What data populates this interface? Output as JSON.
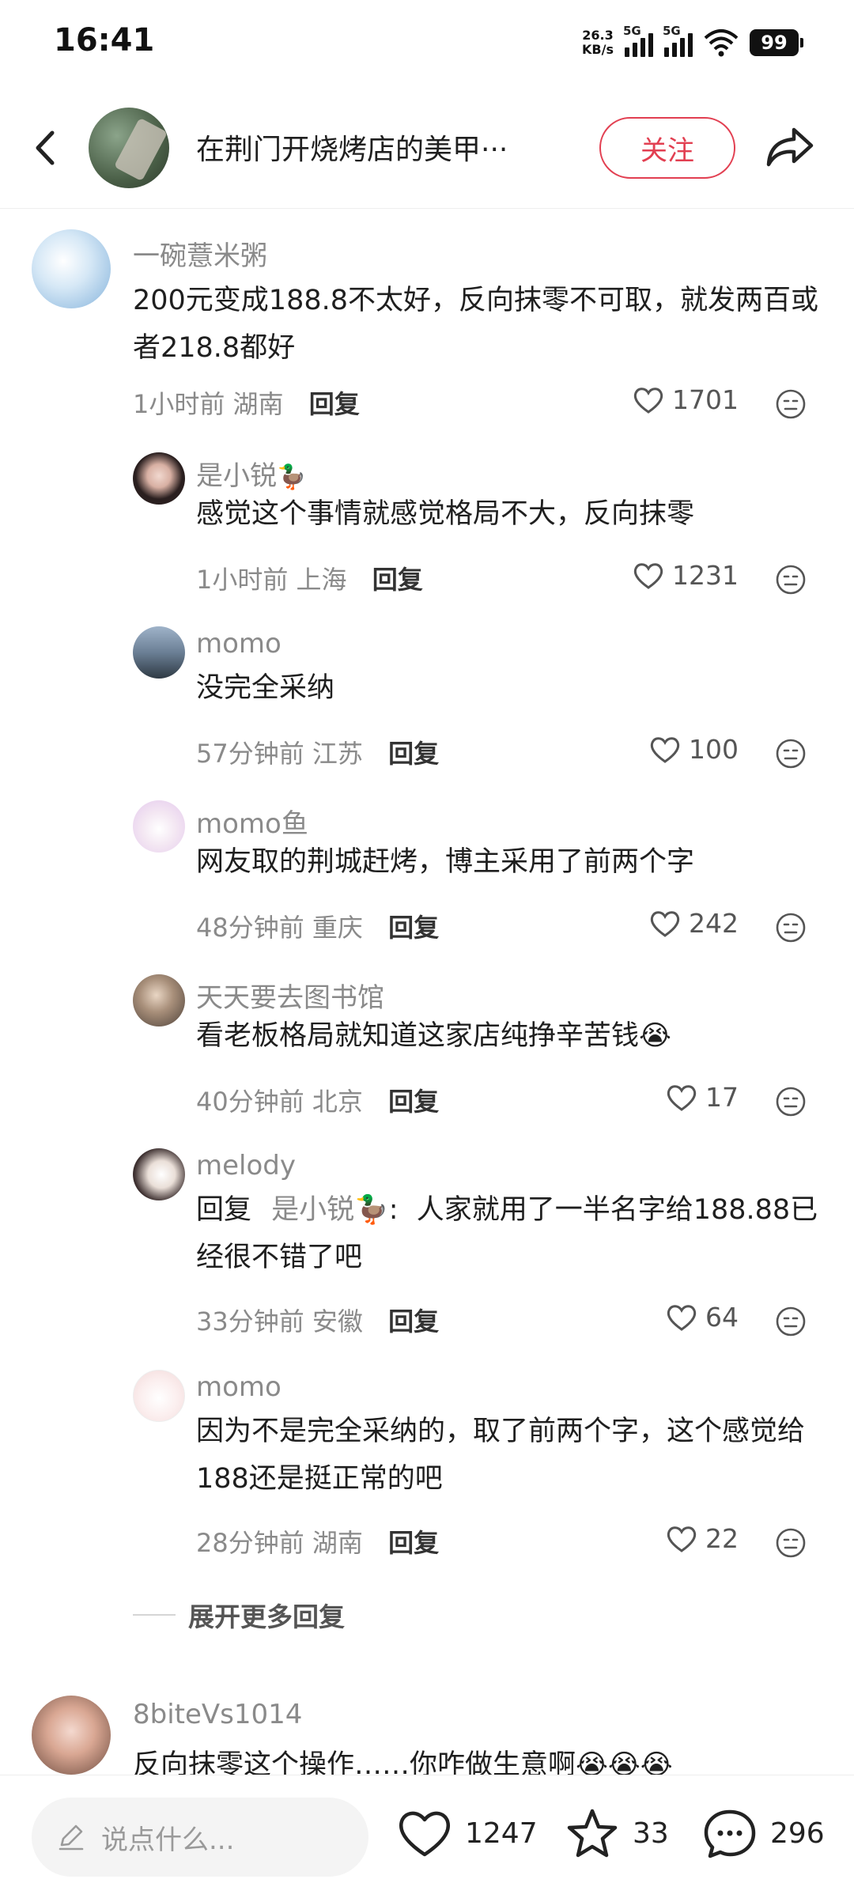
{
  "status": {
    "time": "16:41",
    "speed_value": "26.3",
    "speed_unit": "KB/s",
    "net1": "5G",
    "net2": "5G",
    "battery": "99"
  },
  "header": {
    "title": "在荆门开烧烤店的美甲···",
    "follow_label": "关注"
  },
  "comments": [
    {
      "name": "一碗薏米粥",
      "text": "200元变成188.8不太好，反向抹零不可取，就发两百或者218.8都好",
      "time": "1小时前",
      "location": "湖南",
      "reply_label": "回复",
      "likes": "1701"
    },
    {
      "name": "是小锐",
      "name_emoji": "🦆",
      "text": "感觉这个事情就感觉格局不大，反向抹零",
      "time": "1小时前",
      "location": "上海",
      "reply_label": "回复",
      "likes": "1231"
    },
    {
      "name": "momo",
      "text": "没完全采纳",
      "time": "57分钟前",
      "location": "江苏",
      "reply_label": "回复",
      "likes": "100"
    },
    {
      "name": "momo鱼",
      "text": "网友取的荆城赶烤，博主采用了前两个字",
      "time": "48分钟前",
      "location": "重庆",
      "reply_label": "回复",
      "likes": "242"
    },
    {
      "name": "天天要去图书馆",
      "text": "看老板格局就知道这家店纯挣辛苦钱",
      "text_emoji": "😭",
      "time": "40分钟前",
      "location": "北京",
      "reply_label": "回复",
      "likes": "17"
    },
    {
      "name": "melody",
      "reply_prefix": "回复",
      "mention": "是小锐",
      "mention_emoji": "🦆",
      "colon": ":",
      "text": "人家就用了一半名字给188.88已经很不错了吧",
      "time": "33分钟前",
      "location": "安徽",
      "reply_label": "回复",
      "likes": "64"
    },
    {
      "name": "momo",
      "text": "因为不是完全采纳的，取了前两个字，这个感觉给188还是挺正常的吧",
      "time": "28分钟前",
      "location": "湖南",
      "reply_label": "回复",
      "likes": "22"
    },
    {
      "name": "8biteVs1014",
      "text": "反向抹零这个操作……你咋做生意啊",
      "text_emoji": "😭😭😭"
    }
  ],
  "expand_label": "展开更多回复",
  "bottom": {
    "input_placeholder": "说点什么...",
    "likes": "1247",
    "favorites": "33",
    "comments": "296"
  },
  "colors": {
    "accent": "#e23f51",
    "meta_gray": "#8a8a8a"
  },
  "icons": [
    "back-arrow-icon",
    "share-icon",
    "heart-icon",
    "emoji-face-icon",
    "pencil-icon",
    "star-icon",
    "chat-bubble-icon",
    "wifi-icon",
    "signal-icon",
    "battery-icon"
  ]
}
